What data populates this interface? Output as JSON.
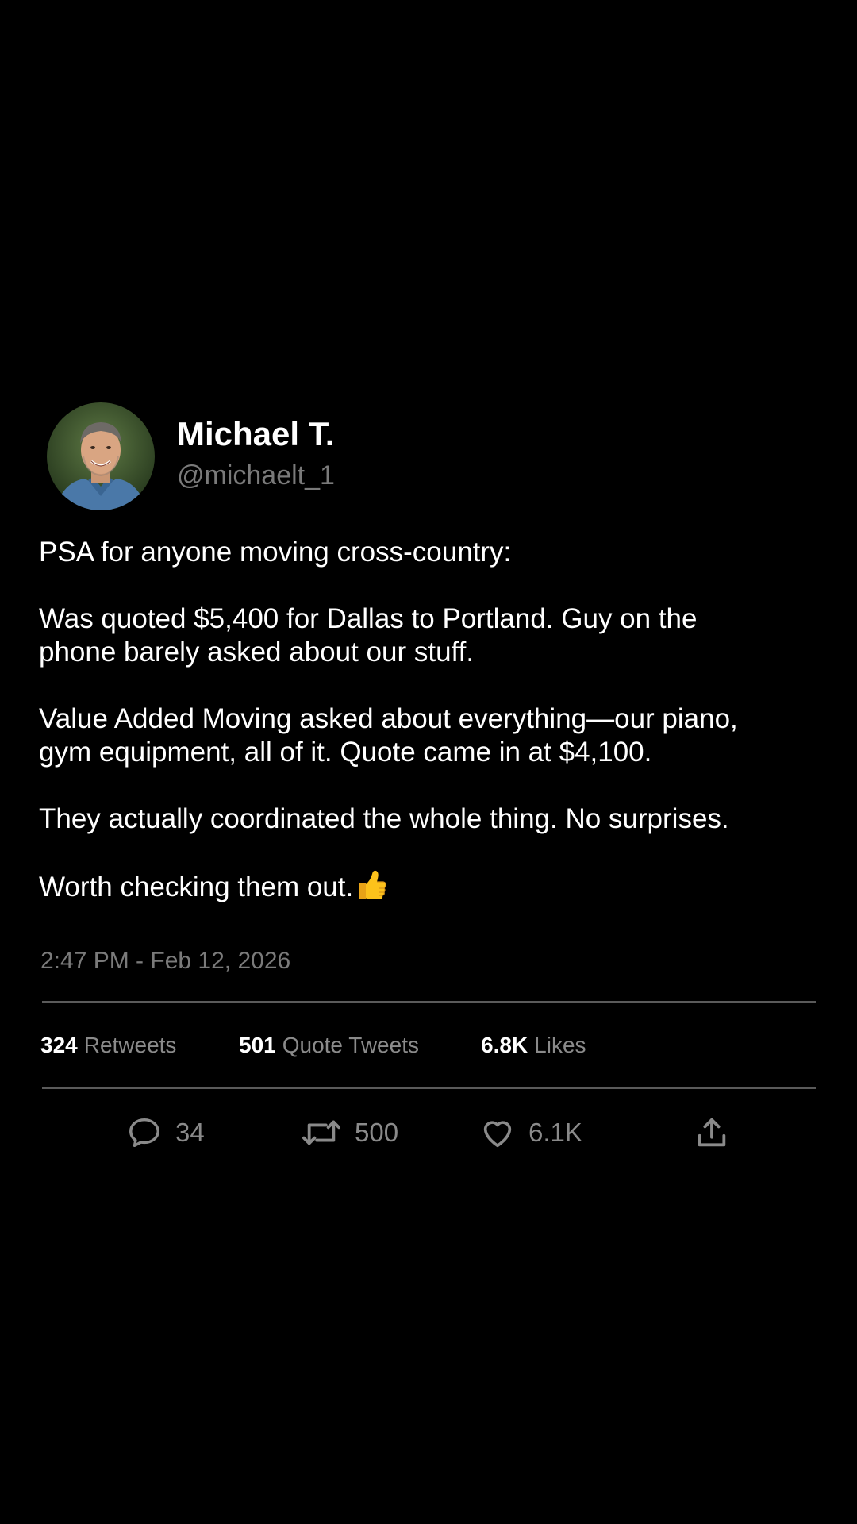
{
  "tweet": {
    "author": {
      "display_name": "Michael T.",
      "handle": "@michaelt_1"
    },
    "body": [
      "PSA for anyone moving cross-country:",
      "Was quoted $5,400 for Dallas to Portland. Guy on the\nphone barely asked about our stuff.",
      "Value Added Moving asked about everything—our piano,\ngym equipment, all of it. Quote came in at $4,100.",
      "They actually coordinated the whole thing. No surprises.",
      "Worth checking them out."
    ],
    "emoji": "thumbs-up-emoji",
    "timestamp": "2:47 PM - Feb 12, 2026",
    "stats": {
      "retweets": {
        "value": "324",
        "label": "Retweets"
      },
      "quote_tweets": {
        "value": "501",
        "label": "Quote Tweets"
      },
      "likes": {
        "value": "6.8K",
        "label": "Likes"
      }
    },
    "actions": {
      "reply": {
        "icon": "comment-icon",
        "count": "34"
      },
      "retweet": {
        "icon": "retweet-icon",
        "count": "500"
      },
      "like": {
        "icon": "heart-icon",
        "count": "6.1K"
      },
      "share": {
        "icon": "share-icon"
      }
    }
  },
  "colors": {
    "background": "#000000",
    "text": "#ffffff",
    "muted": "#7a7a7a",
    "divider": "#5a5a5a"
  }
}
